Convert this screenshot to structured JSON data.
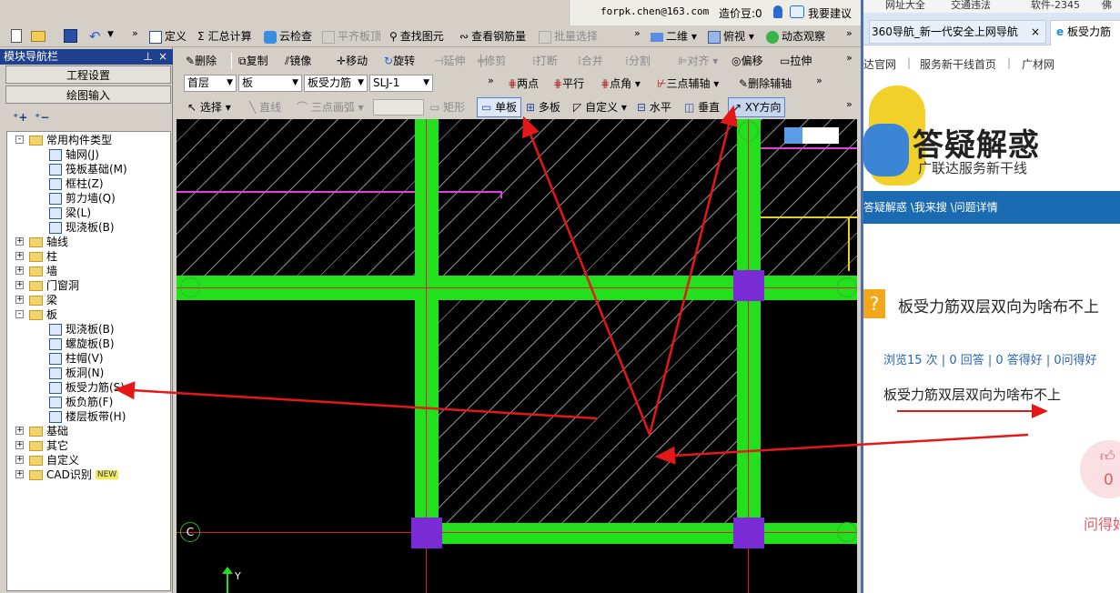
{
  "account": {
    "email": "forpk.chen@163.com",
    "pricing_label": "造价豆:0",
    "suggest_label": "我要建议"
  },
  "main_toolbar": {
    "define": "定义",
    "sum": "汇总计算",
    "cloud_check": "云检查",
    "flush_top": "平齐板顶",
    "find_element": "查找图元",
    "view_rebar": "查看钢筋量",
    "batch_select": "批量选择",
    "view_mode": "二维",
    "view_dir": "俯视",
    "dynamic": "动态观察"
  },
  "edit_toolbar": {
    "delete": "删除",
    "copy": "复制",
    "mirror": "镜像",
    "move": "移动",
    "rotate": "旋转",
    "extend": "延伸",
    "trim": "修剪",
    "break": "打断",
    "merge": "合并",
    "split": "分割",
    "align": "对齐",
    "offset": "偏移",
    "stretch": "拉伸"
  },
  "filter_bar": {
    "floor": "首层",
    "category": "板",
    "type": "板受力筋",
    "name": "SLJ-1",
    "two_points": "两点",
    "parallel": "平行",
    "point_angle": "点角",
    "three_point_axis": "三点辅轴",
    "delete_axis": "删除辅轴"
  },
  "draw_bar": {
    "select": "选择",
    "line": "直线",
    "arc": "三点画弧",
    "rect": "矩形",
    "single": "单板",
    "multi": "多板",
    "custom": "自定义",
    "horizontal": "水平",
    "vertical": "垂直",
    "xy": "XY方向"
  },
  "nav": {
    "title": "模块导航栏",
    "btn_project": "工程设置",
    "btn_draw": "绘图输入",
    "tree": [
      {
        "label": "常用构件类型",
        "level": 0,
        "expand": "-",
        "folder": true
      },
      {
        "label": "轴网(J)",
        "level": 1
      },
      {
        "label": "筏板基础(M)",
        "level": 1
      },
      {
        "label": "框柱(Z)",
        "level": 1
      },
      {
        "label": "剪力墙(Q)",
        "level": 1
      },
      {
        "label": "梁(L)",
        "level": 1
      },
      {
        "label": "现浇板(B)",
        "level": 1
      },
      {
        "label": "轴线",
        "level": 0,
        "expand": "+",
        "folder": true
      },
      {
        "label": "柱",
        "level": 0,
        "expand": "+",
        "folder": true
      },
      {
        "label": "墙",
        "level": 0,
        "expand": "+",
        "folder": true
      },
      {
        "label": "门窗洞",
        "level": 0,
        "expand": "+",
        "folder": true
      },
      {
        "label": "梁",
        "level": 0,
        "expand": "+",
        "folder": true
      },
      {
        "label": "板",
        "level": 0,
        "expand": "-",
        "folder": true
      },
      {
        "label": "现浇板(B)",
        "level": 1
      },
      {
        "label": "螺旋板(B)",
        "level": 1
      },
      {
        "label": "柱帽(V)",
        "level": 1
      },
      {
        "label": "板洞(N)",
        "level": 1
      },
      {
        "label": "板受力筋(S)",
        "level": 1
      },
      {
        "label": "板负筋(F)",
        "level": 1
      },
      {
        "label": "楼层板带(H)",
        "level": 1
      },
      {
        "label": "基础",
        "level": 0,
        "expand": "+",
        "folder": true
      },
      {
        "label": "其它",
        "level": 0,
        "expand": "+",
        "folder": true
      },
      {
        "label": "自定义",
        "level": 0,
        "expand": "+",
        "folder": true
      },
      {
        "label": "CAD识别",
        "level": 0,
        "expand": "+",
        "folder": true,
        "badge": "NEW"
      }
    ]
  },
  "canvas": {
    "axis_c": "C",
    "y_label": "Y"
  },
  "browser": {
    "bookmarks": [
      "网址大全",
      "交通违法",
      "软件-2345",
      "佛"
    ],
    "tabs": [
      "360导航_新一代安全上网导航",
      "板受力筋"
    ],
    "close": "×",
    "site_nav": [
      "达官网",
      "服务新干线首页",
      "广材网"
    ],
    "site_sep": "|",
    "banner_title": "答疑解惑",
    "banner_sub": "广联达服务新干线",
    "breadcrumb": "答疑解惑 \\我来搜 \\问题详情",
    "question_title": "板受力筋双层双向为啥布不上",
    "stats": "浏览15 次 | 0 回答 | 0 答得好 | 0问得好",
    "body": "板受力筋双层双向为啥布不上",
    "like_count": "0",
    "ask_label": "问得好"
  },
  "colors": {
    "slab_green": "#22e01b",
    "column_purple": "#7a2bd6",
    "arrow_red": "#e41818",
    "browser_blue": "#1b6bb3"
  }
}
